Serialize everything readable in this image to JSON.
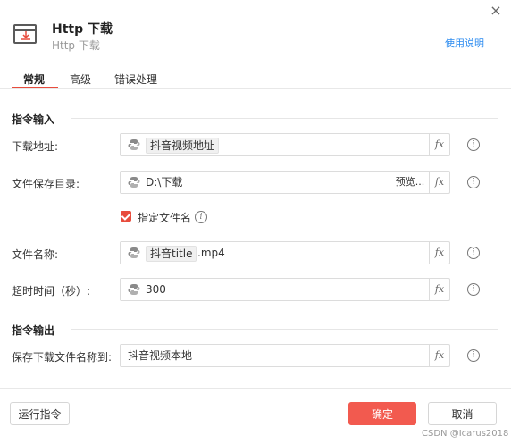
{
  "header": {
    "title": "Http 下载",
    "subtitle": "Http 下载",
    "help_link": "使用说明",
    "close_label": "×",
    "icon": "download-window-icon"
  },
  "tabs": [
    {
      "label": "常规",
      "active": true
    },
    {
      "label": "高级",
      "active": false
    },
    {
      "label": "错误处理",
      "active": false
    }
  ],
  "input_section": {
    "title": "指令输入",
    "download_url": {
      "label": "下载地址:",
      "value": "抖音视频地址"
    },
    "save_dir": {
      "label": "文件保存目录:",
      "value": "D:\\下载",
      "browse_label": "预览..."
    },
    "specify_name": {
      "label": "指定文件名",
      "checked": true
    },
    "file_name": {
      "label": "文件名称:",
      "var": "抖音title",
      "suffix": ".mp4"
    },
    "timeout": {
      "label": "超时时间（秒）:",
      "value": "300"
    }
  },
  "output_section": {
    "title": "指令输出",
    "save_to": {
      "label": "保存下载文件名称到:",
      "value": "抖音视频本地"
    }
  },
  "fx_label": "fx",
  "info_glyph": "i",
  "footer": {
    "run_label": "运行指令",
    "confirm_label": "确定",
    "cancel_label": "取消"
  },
  "watermark": "CSDN @Icarus2018",
  "colors": {
    "accent": "#e84c3d",
    "primary_button": "#f25a4f",
    "link": "#2d8cf0"
  }
}
